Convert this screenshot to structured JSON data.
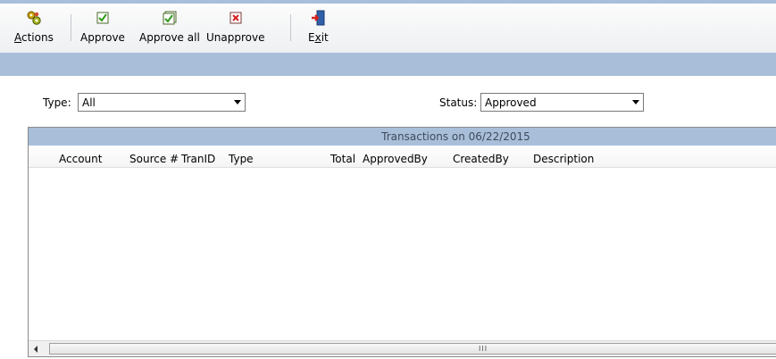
{
  "toolbar": {
    "actions_label": "Actions",
    "approve_label": "Approve",
    "approve_all_label": "Approve all",
    "unapprove_label": "Unapprove",
    "exit_label": "Exit"
  },
  "filters": {
    "type_label": "Type:",
    "type_value": "All",
    "status_label": "Status:",
    "status_value": "Approved"
  },
  "grid": {
    "title": "Transactions on 06/22/2015",
    "columns": [
      "Account",
      "Source #",
      "TranID",
      "Type",
      "Total",
      "ApprovedBy",
      "CreatedBy",
      "Description"
    ],
    "rows": []
  },
  "scrollbar": {
    "grip": "III"
  },
  "colors": {
    "band": "#a9bfd9",
    "title_text": "#3e4a5a"
  }
}
